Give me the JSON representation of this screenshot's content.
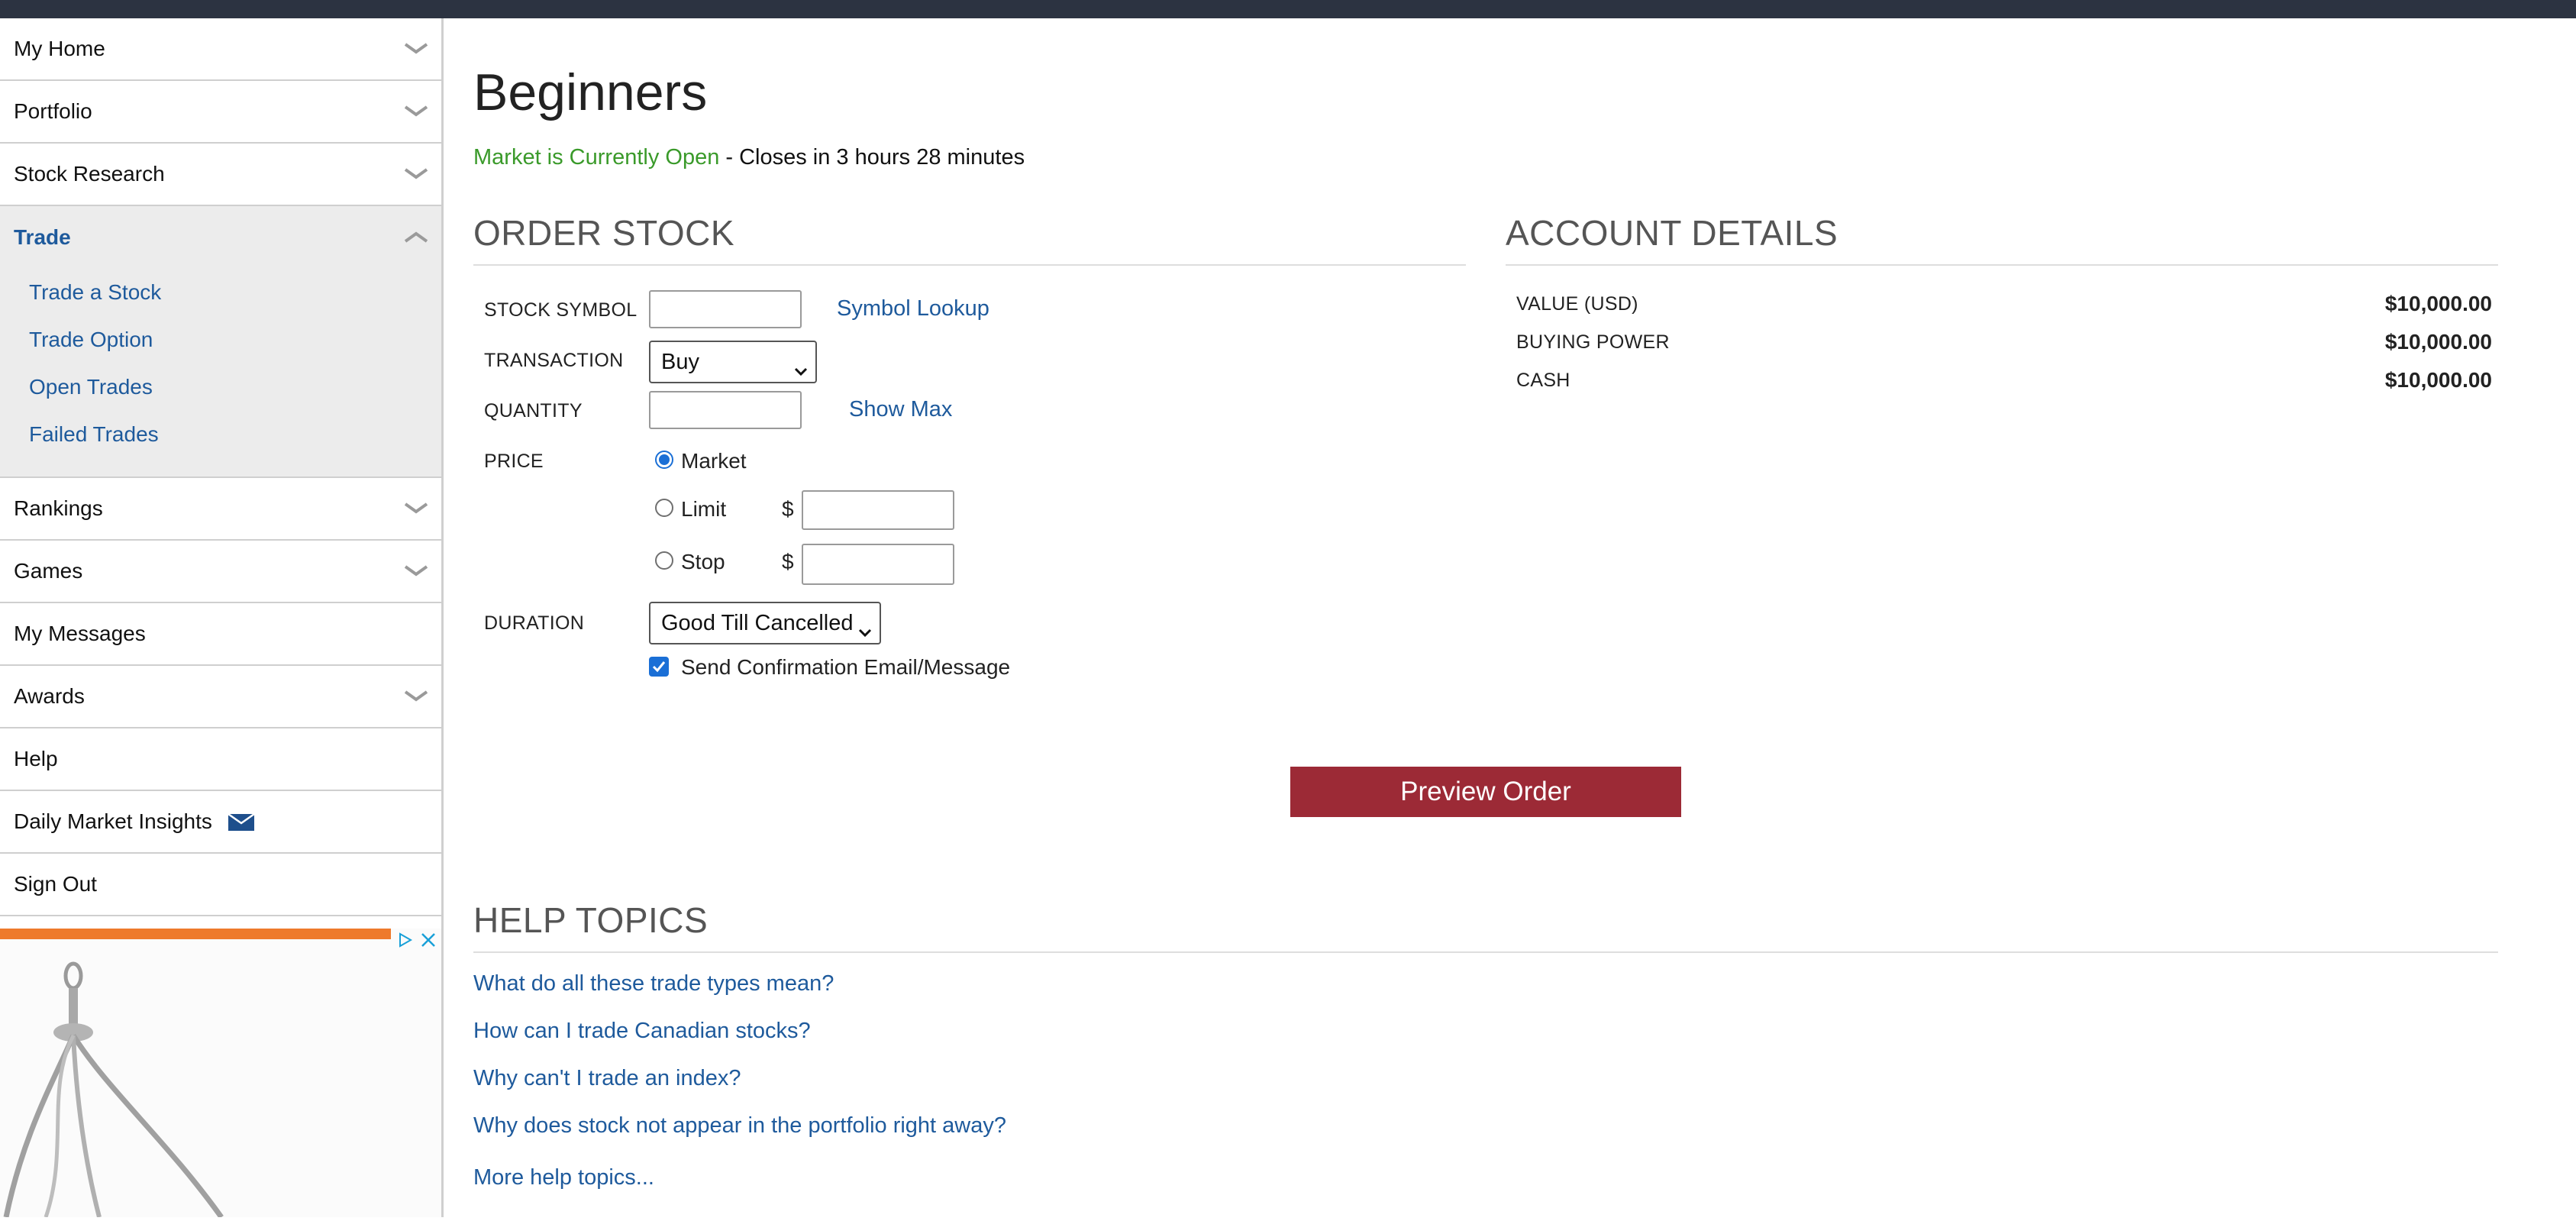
{
  "sidebar": {
    "items_top": [
      {
        "label": "My Home",
        "chevron": "down"
      },
      {
        "label": "Portfolio",
        "chevron": "down"
      },
      {
        "label": "Stock Research",
        "chevron": "down"
      }
    ],
    "trade": {
      "label": "Trade",
      "chevron": "up",
      "sub_items": [
        "Trade a Stock",
        "Trade Option",
        "Open Trades",
        "Failed Trades"
      ]
    },
    "items_bottom": [
      {
        "label": "Rankings",
        "chevron": "down"
      },
      {
        "label": "Games",
        "chevron": "down"
      },
      {
        "label": "My Messages",
        "chevron": ""
      },
      {
        "label": "Awards",
        "chevron": "down"
      },
      {
        "label": "Help",
        "chevron": ""
      },
      {
        "label": "Daily Market Insights",
        "chevron": "",
        "icon": "mail-icon"
      },
      {
        "label": "Sign Out",
        "chevron": ""
      }
    ]
  },
  "page": {
    "title": "Beginners",
    "market_status": "Market is Currently Open",
    "market_closes": " - Closes in 3 hours 28 minutes"
  },
  "order": {
    "heading": "ORDER STOCK",
    "stock_symbol_label": "STOCK SYMBOL",
    "stock_symbol_value": "",
    "symbol_lookup": "Symbol Lookup",
    "transaction_label": "TRANSACTION",
    "transaction_value": "Buy",
    "quantity_label": "QUANTITY",
    "quantity_value": "",
    "show_max": "Show Max",
    "price_label": "PRICE",
    "price_options": [
      {
        "label": "Market",
        "checked": true
      },
      {
        "label": "Limit",
        "checked": false
      },
      {
        "label": "Stop",
        "checked": false
      }
    ],
    "currency_symbol": "$",
    "duration_label": "DURATION",
    "duration_value": "Good Till Cancelled",
    "confirm_label": "Send Confirmation Email/Message",
    "confirm_checked": true,
    "preview_button": "Preview Order"
  },
  "account": {
    "heading": "ACCOUNT DETAILS",
    "rows": [
      {
        "label": "VALUE (USD)",
        "value": "$10,000.00"
      },
      {
        "label": "BUYING POWER",
        "value": "$10,000.00"
      },
      {
        "label": "CASH",
        "value": "$10,000.00"
      }
    ]
  },
  "help": {
    "heading": "HELP TOPICS",
    "links": [
      "What do all these trade types mean?",
      "How can I trade Canadian stocks?",
      "Why can't I trade an index?",
      "Why does stock not appear in the portfolio right away?"
    ],
    "more": "More help topics..."
  },
  "colors": {
    "link": "#1e5a9c",
    "open_status": "#3a9a2a",
    "preview_button": "#9c2a36",
    "topbar": "#2c3341",
    "ad_bar": "#ee7a2c"
  }
}
